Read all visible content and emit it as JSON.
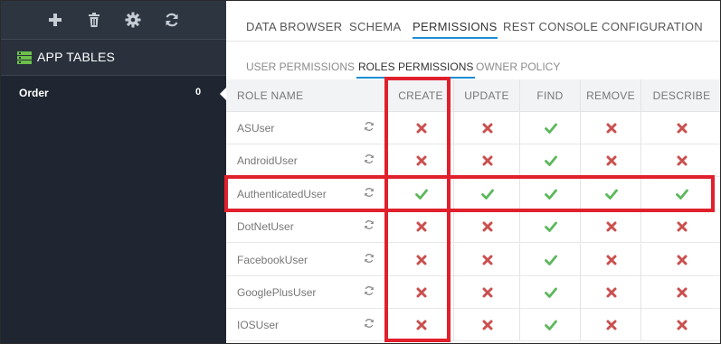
{
  "sidebar": {
    "toolbar_icons": [
      "plus-icon",
      "trash-icon",
      "gear-icon",
      "refresh-icon"
    ],
    "section_title": "APP TABLES",
    "tables": [
      {
        "name": "Order",
        "count": "0"
      }
    ]
  },
  "tabs": [
    {
      "label": "DATA BROWSER",
      "active": false
    },
    {
      "label": "SCHEMA",
      "active": false
    },
    {
      "label": "PERMISSIONS",
      "active": true
    },
    {
      "label": "REST CONSOLE",
      "active": false
    },
    {
      "label": "CONFIGURATION",
      "active": false
    }
  ],
  "subtabs": [
    {
      "label": "USER PERMISSIONS",
      "active": false
    },
    {
      "label": "ROLES PERMISSIONS",
      "active": true
    },
    {
      "label": "OWNER POLICY",
      "active": false
    }
  ],
  "grid": {
    "role_header": "ROLE NAME",
    "columns": [
      "CREATE",
      "UPDATE",
      "FIND",
      "REMOVE",
      "DESCRIBE"
    ],
    "rows": [
      {
        "role": "ASUser",
        "perms": [
          "deny",
          "deny",
          "grant",
          "deny",
          "deny"
        ]
      },
      {
        "role": "AndroidUser",
        "perms": [
          "deny",
          "deny",
          "grant",
          "deny",
          "deny"
        ]
      },
      {
        "role": "AuthenticatedUser",
        "perms": [
          "grant",
          "grant",
          "grant",
          "grant",
          "grant"
        ]
      },
      {
        "role": "DotNetUser",
        "perms": [
          "deny",
          "deny",
          "grant",
          "deny",
          "deny"
        ]
      },
      {
        "role": "FacebookUser",
        "perms": [
          "deny",
          "deny",
          "grant",
          "deny",
          "deny"
        ]
      },
      {
        "role": "GooglePlusUser",
        "perms": [
          "deny",
          "deny",
          "grant",
          "deny",
          "deny"
        ]
      },
      {
        "role": "IOSUser",
        "perms": [
          "deny",
          "deny",
          "grant",
          "deny",
          "deny"
        ]
      }
    ]
  },
  "colors": {
    "grant": "#5cb85c",
    "deny": "#c9504f",
    "highlight": "#e0202c",
    "accent": "#1f8dd6"
  }
}
